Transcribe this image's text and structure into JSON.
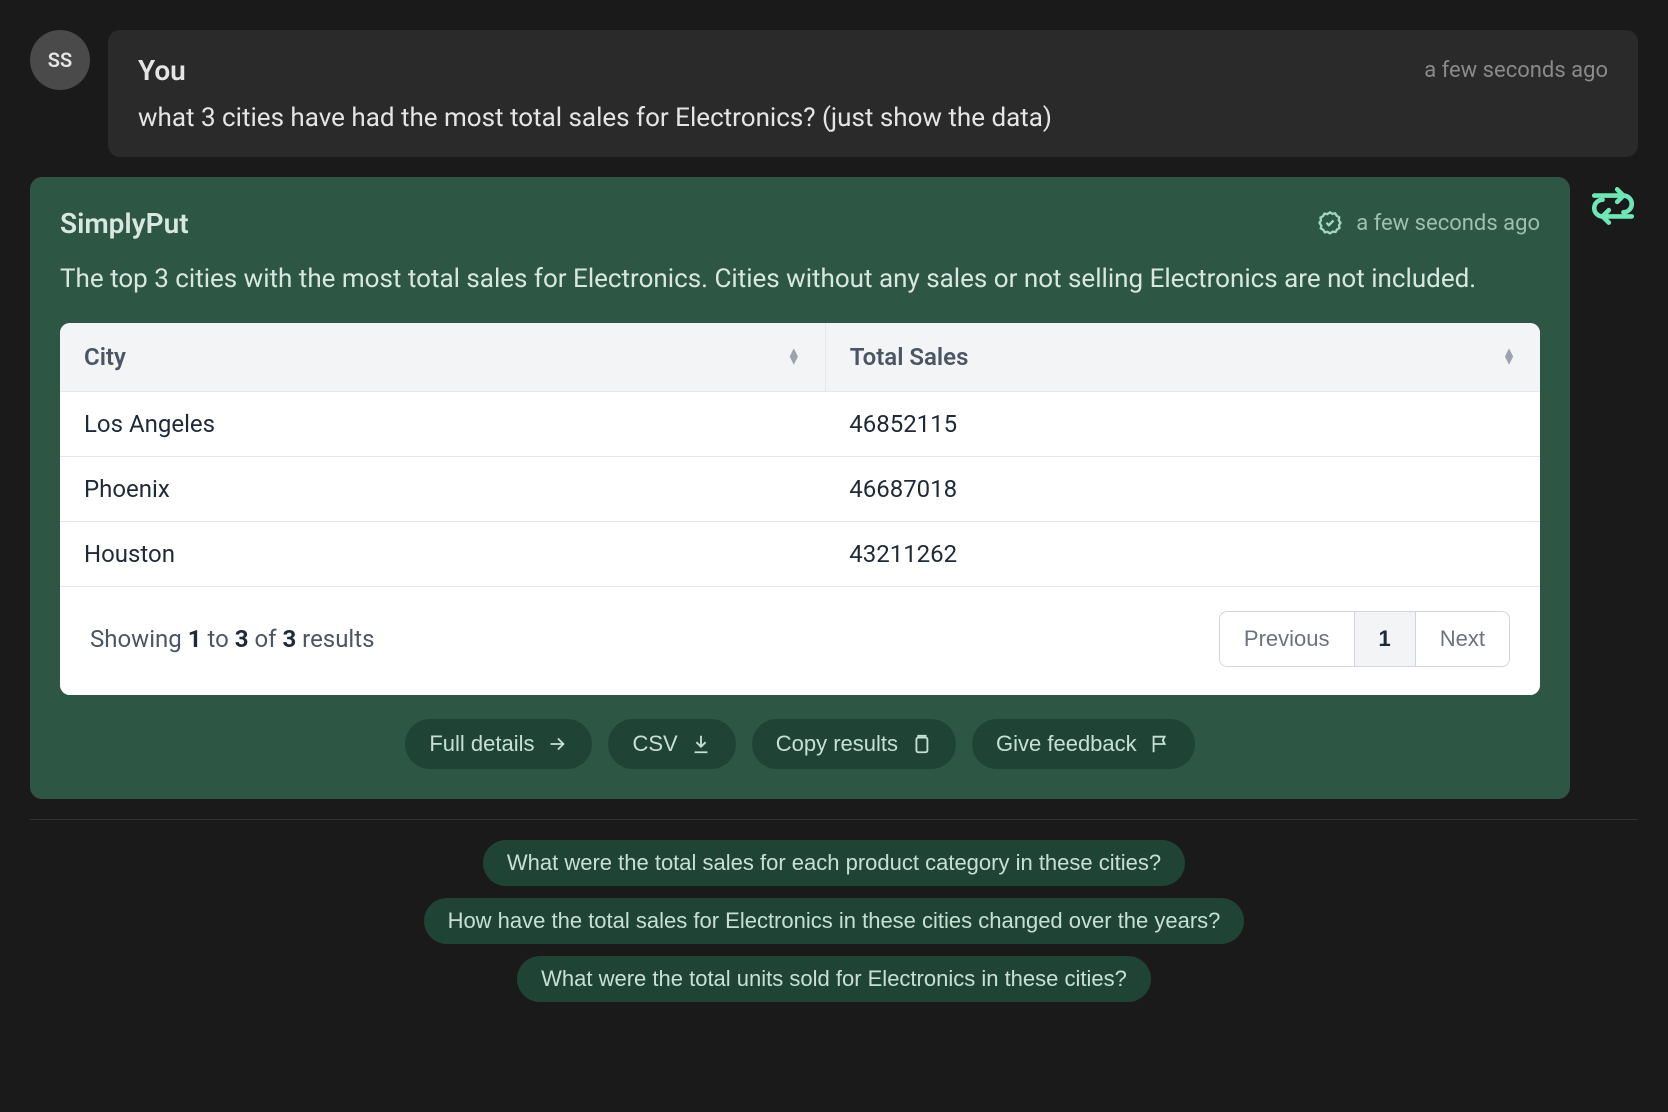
{
  "user": {
    "avatar_initials": "SS",
    "author": "You",
    "timestamp": "a few seconds ago",
    "message": "what 3 cities have had the most total sales for Electronics? (just show the data)"
  },
  "response": {
    "author": "SimplyPut",
    "timestamp": "a few seconds ago",
    "description": "The top 3 cities with the most total sales for Electronics. Cities without any sales or not selling Electronics are not included.",
    "table": {
      "columns": [
        "City",
        "Total Sales"
      ],
      "rows": [
        {
          "city": "Los Angeles",
          "total_sales": "46852115"
        },
        {
          "city": "Phoenix",
          "total_sales": "46687018"
        },
        {
          "city": "Houston",
          "total_sales": "43211262"
        }
      ],
      "footer": {
        "showing_prefix": "Showing ",
        "from": "1",
        "to_word": " to ",
        "to": "3",
        "of_word": " of ",
        "total": "3",
        "results_word": " results"
      },
      "pager": {
        "previous": "Previous",
        "page": "1",
        "next": "Next"
      }
    },
    "actions": {
      "full_details": "Full details",
      "csv": "CSV",
      "copy_results": "Copy results",
      "give_feedback": "Give feedback"
    }
  },
  "suggestions": [
    "What were the total sales for each product category in these cities?",
    "How have the total sales for Electronics in these cities changed over the years?",
    "What were the total units sold for Electronics in these cities?"
  ]
}
